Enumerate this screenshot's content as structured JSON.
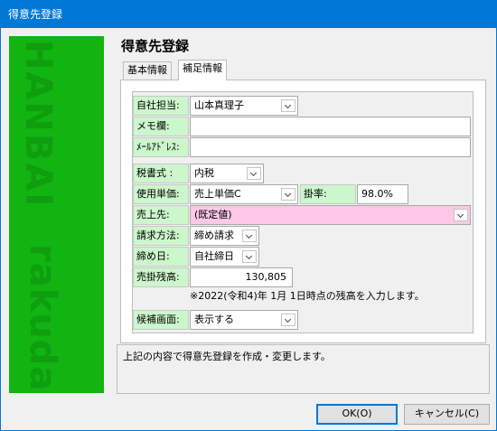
{
  "window": {
    "title": "得意先登録"
  },
  "banner": {
    "text_top": "HANBAI",
    "text_bottom": "rakuda"
  },
  "form": {
    "title": "得意先登録"
  },
  "tabs": [
    {
      "label": "基本情報"
    },
    {
      "label": "補足情報"
    }
  ],
  "fields": {
    "sales_rep": {
      "label": "自社担当:",
      "value": "山本真理子"
    },
    "memo": {
      "label": "メモ欄:",
      "value": ""
    },
    "email": {
      "label": "ﾒｰﾙｱﾄﾞﾚｽ:",
      "value": ""
    },
    "tax_type": {
      "label": "税書式 :",
      "value": "内税"
    },
    "unit_price": {
      "label": "使用単価:",
      "value": "売上単価C"
    },
    "rate": {
      "label": "掛率:",
      "value": "98.0%"
    },
    "sales_dest": {
      "label": "売上先:",
      "value": "(既定値)"
    },
    "billing_method": {
      "label": "請求方法:",
      "value": "締め請求"
    },
    "closing_day": {
      "label": "締め日:",
      "value": "自社締日"
    },
    "ar_balance": {
      "label": "売掛残高:",
      "value": "130,805"
    },
    "candidate_screen": {
      "label": "候補画面:",
      "value": "表示する"
    }
  },
  "note": "※2022(令和4)年 1月 1日時点の残高を入力します。",
  "message": "上記の内容で得意先登録を作成・変更します。",
  "buttons": {
    "ok": "OK(O)",
    "cancel": "キャンセル(C)"
  },
  "colors": {
    "accent": "#0078d7",
    "banner": "#11b411",
    "label_bg": "#ccf6cc",
    "highlight_field": "#fec8e6"
  }
}
